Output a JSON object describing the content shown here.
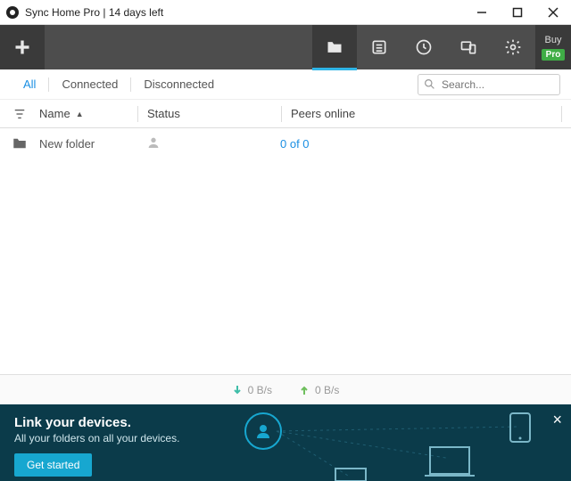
{
  "titlebar": {
    "title": "Sync Home Pro | 14 days left"
  },
  "toolbar": {
    "buy_label": "Buy",
    "pro_label": "Pro"
  },
  "filters": {
    "all": "All",
    "connected": "Connected",
    "disconnected": "Disconnected"
  },
  "search": {
    "placeholder": "Search..."
  },
  "columns": {
    "name": "Name",
    "status": "Status",
    "peers": "Peers online"
  },
  "rows": [
    {
      "name": "New folder",
      "peers": "0 of 0"
    }
  ],
  "status": {
    "down": "0 B/s",
    "up": "0 B/s"
  },
  "banner": {
    "title": "Link your devices.",
    "subtitle": "All your folders on all your devices.",
    "cta": "Get started"
  }
}
